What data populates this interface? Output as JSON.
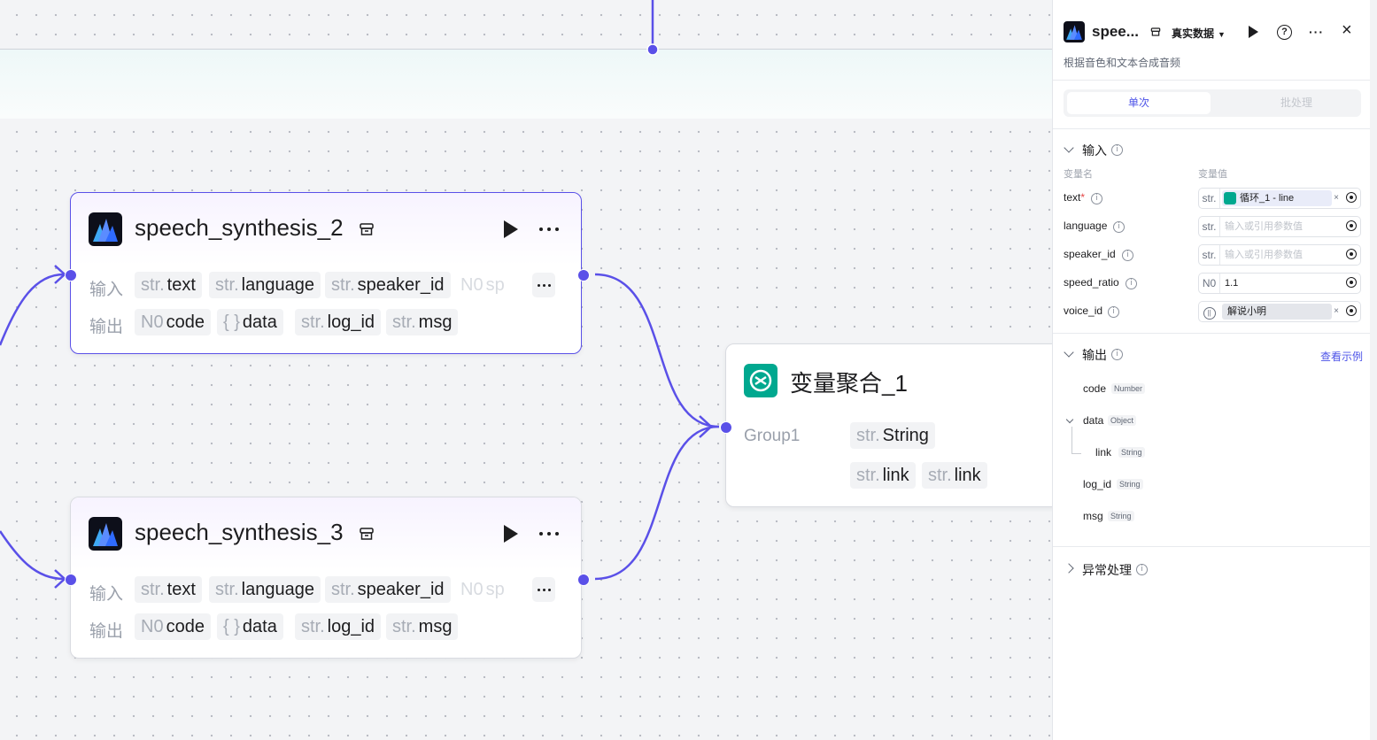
{
  "canvas": {
    "nodes": [
      {
        "title": "speech_synthesis_2",
        "input_label": "输入",
        "output_label": "输出",
        "inputs": [
          {
            "type": "str.",
            "name": "text"
          },
          {
            "type": "str.",
            "name": "language"
          },
          {
            "type": "str.",
            "name": "speaker_id"
          },
          {
            "type": "N0",
            "name": "sp"
          }
        ],
        "outputs": [
          {
            "type": "N0",
            "name": "code"
          },
          {
            "type": "{ }",
            "name": "data"
          },
          {
            "type": "str.",
            "name": "log_id"
          },
          {
            "type": "str.",
            "name": "msg"
          }
        ]
      },
      {
        "title": "speech_synthesis_3",
        "input_label": "输入",
        "output_label": "输出",
        "inputs": [
          {
            "type": "str.",
            "name": "text"
          },
          {
            "type": "str.",
            "name": "language"
          },
          {
            "type": "str.",
            "name": "speaker_id"
          },
          {
            "type": "N0",
            "name": "sp"
          }
        ],
        "outputs": [
          {
            "type": "N0",
            "name": "code"
          },
          {
            "type": "{ }",
            "name": "data"
          },
          {
            "type": "str.",
            "name": "log_id"
          },
          {
            "type": "str.",
            "name": "msg"
          }
        ]
      }
    ],
    "aggregator": {
      "title": "变量聚合_1",
      "group_label": "Group1",
      "type_chip": {
        "type": "str.",
        "name": "String"
      },
      "vars": [
        {
          "type": "str.",
          "name": "link"
        },
        {
          "type": "str.",
          "name": "link"
        }
      ]
    }
  },
  "panel": {
    "title": "spee...",
    "data_mode": "真实数据",
    "description": "根据音色和文本合成音频",
    "tabs": [
      "单次",
      "批处理"
    ],
    "input": {
      "title": "输入",
      "col_name": "变量名",
      "col_value": "变量值",
      "rows": [
        {
          "name": "text",
          "required": "*",
          "type": "str.",
          "value": "循环_1 - line",
          "kind": "ref"
        },
        {
          "name": "language",
          "required": "",
          "type": "str.",
          "value": "输入或引用参数值",
          "kind": "placeholder"
        },
        {
          "name": "speaker_id",
          "required": "",
          "type": "str.",
          "value": "输入或引用参数值",
          "kind": "placeholder"
        },
        {
          "name": "speed_ratio",
          "required": "",
          "type": "N0",
          "value": "1.1",
          "kind": "value"
        },
        {
          "name": "voice_id",
          "required": "",
          "type": "",
          "value": "解说小明",
          "kind": "voice"
        }
      ]
    },
    "output": {
      "title": "输出",
      "example_link": "查看示例",
      "items": [
        {
          "name": "code",
          "type": "Number"
        },
        {
          "name": "data",
          "type": "Object"
        },
        {
          "name": "link",
          "type": "String"
        },
        {
          "name": "log_id",
          "type": "String"
        },
        {
          "name": "msg",
          "type": "String"
        }
      ]
    },
    "error": {
      "title": "异常处理"
    }
  },
  "colors": {
    "accent": "#5a50e8",
    "link": "#4d53e8",
    "agg": "#00a88f"
  }
}
